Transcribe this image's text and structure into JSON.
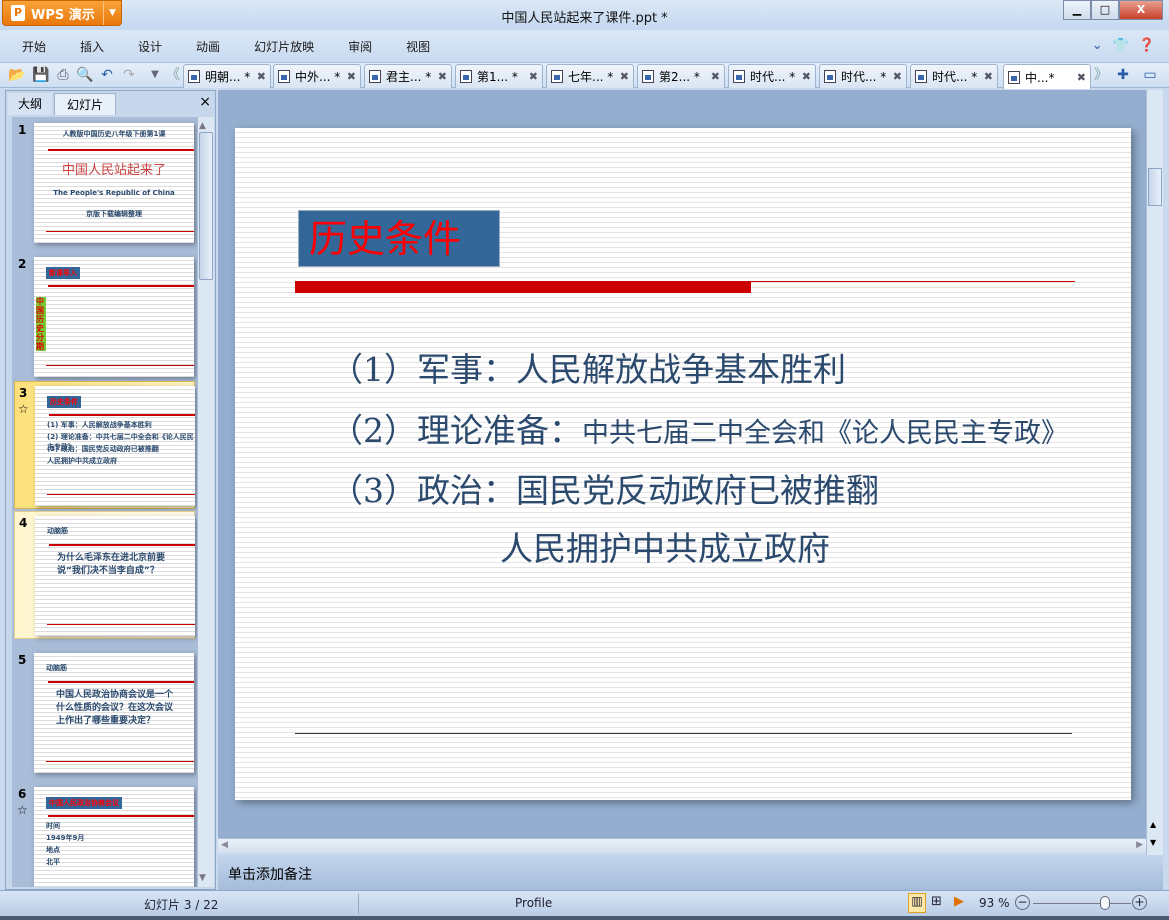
{
  "app": {
    "name": "WPS 演示",
    "title": "中国人民站起来了课件.ppt *"
  },
  "window_buttons": {
    "minimize": "▁",
    "maximize": "□",
    "close": "X"
  },
  "menu": [
    "开始",
    "插入",
    "设计",
    "动画",
    "幻灯片放映",
    "审阅",
    "视图"
  ],
  "doc_tabs": [
    {
      "label": "明朝... *"
    },
    {
      "label": "中外... *"
    },
    {
      "label": "君主... *"
    },
    {
      "label": "第1... *"
    },
    {
      "label": "七年... *"
    },
    {
      "label": "第2... *"
    },
    {
      "label": "时代... *"
    },
    {
      "label": "时代... *"
    },
    {
      "label": "时代... *"
    },
    {
      "label": "中...*",
      "active": true
    }
  ],
  "panel": {
    "tabs": [
      "大纲",
      "幻灯片"
    ],
    "active_tab": "幻灯片",
    "close": "×"
  },
  "thumbnails": [
    {
      "num": "1",
      "star": false,
      "lines": [
        "人教版中国历史八年级下册第1课",
        "中国人民站起来了",
        "The People's Republic of China",
        "京版下载编辑整理"
      ]
    },
    {
      "num": "2",
      "star": false,
      "lines": [
        "新课导入",
        "中国历史分期"
      ]
    },
    {
      "num": "3",
      "star": true,
      "selected": true,
      "lines": [
        "历史条件",
        "(1) 军事：人民解放战争基本胜利",
        "(2) 理论准备：中共七届二中全会和《论人民民主专政》",
        "(3) 政治：国民党反动政府已被推翻",
        "人民拥护中共成立政府"
      ]
    },
    {
      "num": "4",
      "star": false,
      "lines": [
        "动脑筋",
        "为什么毛泽东在进北京前要说“我们决不当李自成”？"
      ]
    },
    {
      "num": "5",
      "star": false,
      "lines": [
        "动脑筋",
        "中国人民政治协商会议是一个什么性质的会议？在这次会议上作出了哪些重要决定？"
      ]
    },
    {
      "num": "6",
      "star": true,
      "lines": [
        "中国人民政治协商会议",
        "时间",
        "1949年9月",
        "地点",
        "北平"
      ]
    }
  ],
  "slide": {
    "title": "历史条件",
    "bullets": [
      {
        "prefix": "（1）军事：",
        "text": "人民解放战争基本胜利"
      },
      {
        "prefix": "（2）理论准备：",
        "text": "中共七届二中全会和《论人民民主专政》"
      },
      {
        "prefix": "（3）政治：",
        "text": "国民党反动政府已被推翻"
      },
      {
        "prefix": "",
        "text": "人民拥护中共成立政府"
      }
    ]
  },
  "notes": {
    "placeholder": "单击添加备注"
  },
  "status": {
    "slide_counter": "幻灯片 3 / 22",
    "theme": "Profile",
    "zoom": "93 %",
    "zoom_level": 93
  },
  "colors": {
    "title_box": "#336699",
    "title_text": "#ff0000",
    "accent_red": "#cc0000",
    "body_text": "#2b4a6e",
    "app_orange": "#e9780b"
  }
}
